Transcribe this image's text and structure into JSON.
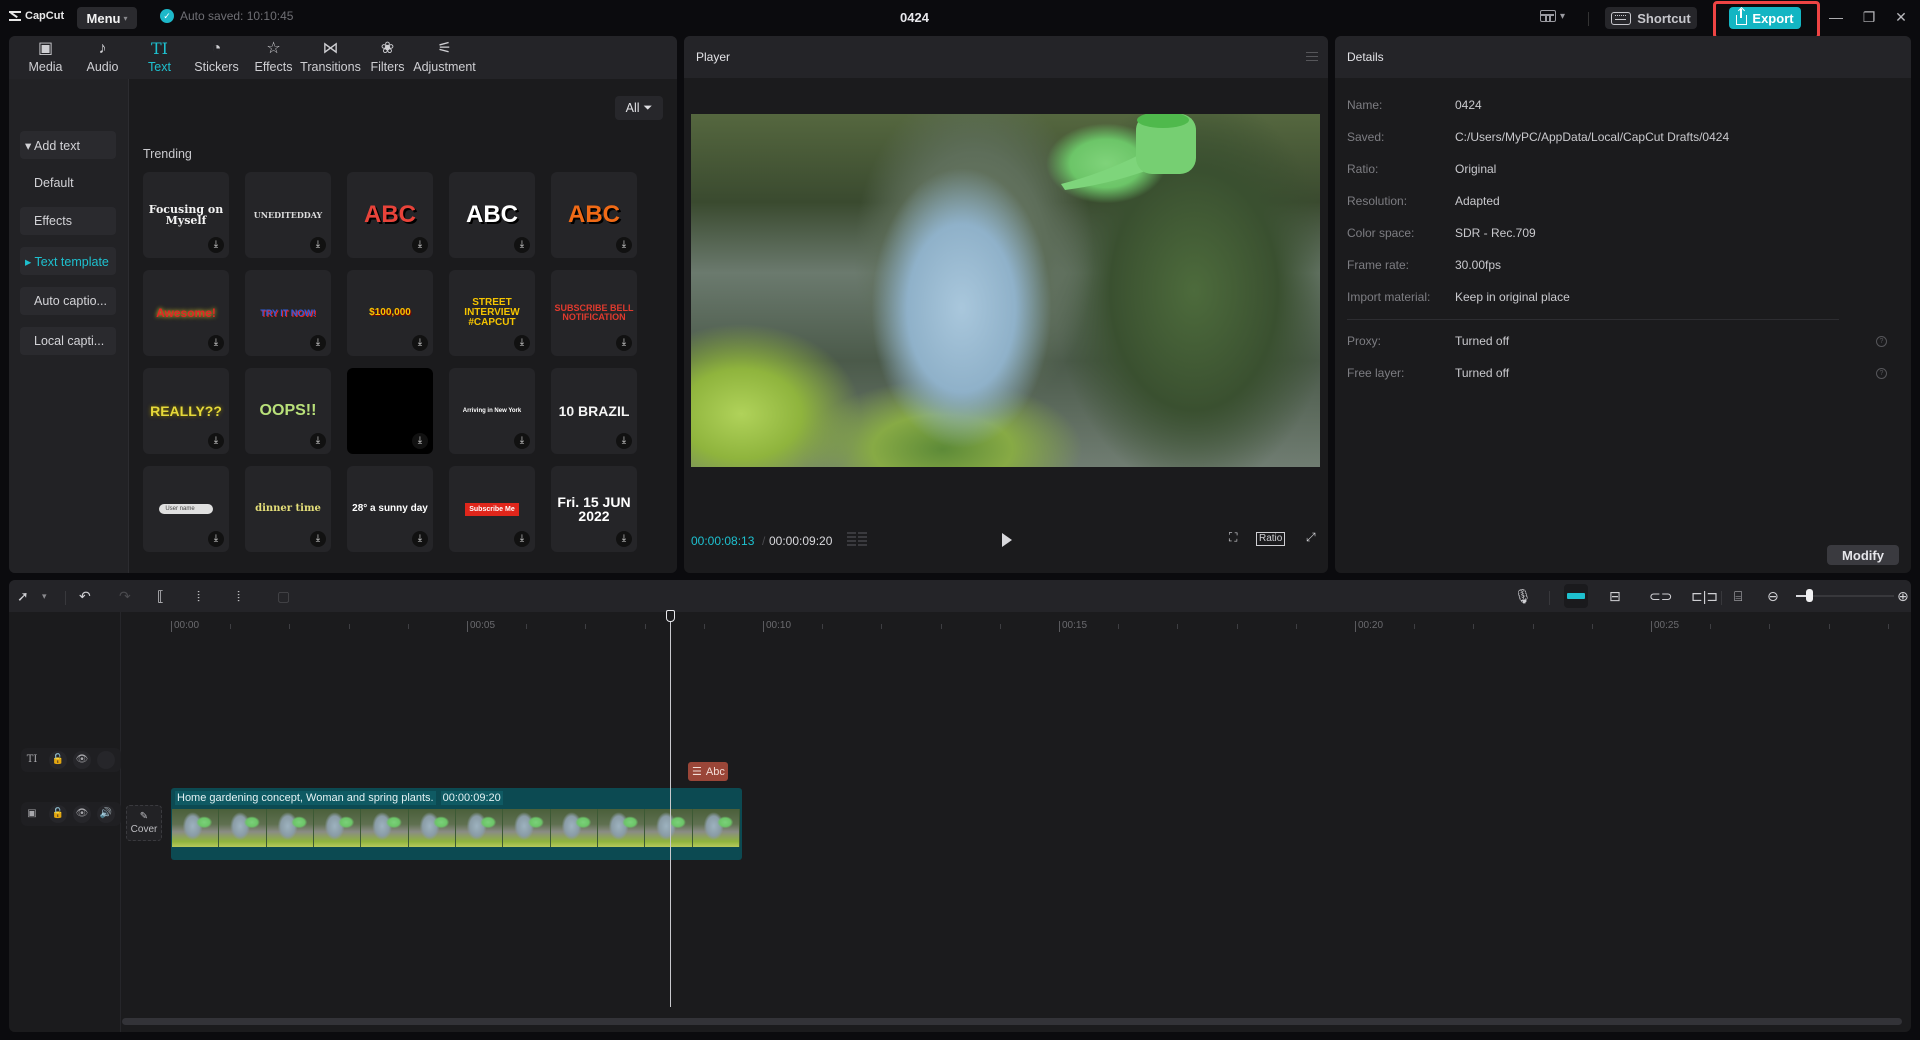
{
  "app": {
    "logo_text": "CapCut",
    "menu_label": "Menu",
    "autosave_text": "Auto saved: 10:10:45",
    "project_title": "0424",
    "shortcut_label": "Shortcut",
    "export_label": "Export",
    "accent_color": "#13b5c3",
    "annotation_color": "#ee4444"
  },
  "categories": [
    {
      "label": "Media",
      "icon": "media-icon",
      "glyph": "▣"
    },
    {
      "label": "Audio",
      "icon": "audio-icon",
      "glyph": "♪"
    },
    {
      "label": "Text",
      "icon": "text-icon",
      "glyph": "TI",
      "active": true
    },
    {
      "label": "Stickers",
      "icon": "sticker-icon",
      "glyph": "◔"
    },
    {
      "label": "Effects",
      "icon": "effects-icon",
      "glyph": "☆"
    },
    {
      "label": "Transitions",
      "icon": "transitions-icon",
      "glyph": "⋈"
    },
    {
      "label": "Filters",
      "icon": "filters-icon",
      "glyph": "❀"
    },
    {
      "label": "Adjustment",
      "icon": "adjustment-icon",
      "glyph": "⚟"
    }
  ],
  "text_sidebar": {
    "items": [
      {
        "label": "▾ Add text"
      },
      {
        "label": "Default"
      },
      {
        "label": "Effects"
      },
      {
        "label": "▸ Text template"
      },
      {
        "label": "Auto captio..."
      },
      {
        "label": "Local capti..."
      }
    ]
  },
  "filter": {
    "label": "All"
  },
  "templates": {
    "section": "Trending",
    "items": [
      {
        "label": "Focusing on Myself"
      },
      {
        "label": "UNEDITEDDAY"
      },
      {
        "label": "ABC"
      },
      {
        "label": "ABC"
      },
      {
        "label": "ABC"
      },
      {
        "label": "Awesome!"
      },
      {
        "label": "TRY IT NOW!"
      },
      {
        "label": "$100,000"
      },
      {
        "label": "STREET INTERVIEW #CAPCUT"
      },
      {
        "label": "SUBSCRIBE BELL NOTIFICATION"
      },
      {
        "label": "REALLY??"
      },
      {
        "label": "OOPS!!"
      },
      {
        "label": ""
      },
      {
        "label": "Arriving in New York"
      },
      {
        "label": "10 BRAZIL"
      },
      {
        "label": "User name"
      },
      {
        "label": "dinner time"
      },
      {
        "label": "28° a sunny day"
      },
      {
        "label": "Subscribe Me"
      },
      {
        "label": "Fri. 15 JUN 2022"
      }
    ]
  },
  "player": {
    "title": "Player",
    "current_time": "00:00:08:13",
    "total_time": "00:00:09:20",
    "ratio_label": "Ratio"
  },
  "details": {
    "title": "Details",
    "rows": [
      {
        "label": "Name:",
        "value": "0424"
      },
      {
        "label": "Saved:",
        "value": "C:/Users/MyPC/AppData/Local/CapCut Drafts/0424"
      },
      {
        "label": "Ratio:",
        "value": "Original"
      },
      {
        "label": "Resolution:",
        "value": "Adapted"
      },
      {
        "label": "Color space:",
        "value": "SDR - Rec.709"
      },
      {
        "label": "Frame rate:",
        "value": "30.00fps"
      },
      {
        "label": "Import material:",
        "value": "Keep in original place"
      }
    ],
    "settings": [
      {
        "label": "Proxy:",
        "value": "Turned off"
      },
      {
        "label": "Free layer:",
        "value": "Turned off"
      }
    ],
    "modify_label": "Modify"
  },
  "timeline": {
    "ruler_labels": [
      "00:00",
      "00:05",
      "00:10",
      "00:15",
      "00:20",
      "00:25"
    ],
    "playhead_seconds": 8.43,
    "text_clip_label": "Abc",
    "video_clip": {
      "title": "Home gardening concept, Woman and spring plants.",
      "duration": "00:00:09:20"
    },
    "cover_label": "Cover"
  }
}
